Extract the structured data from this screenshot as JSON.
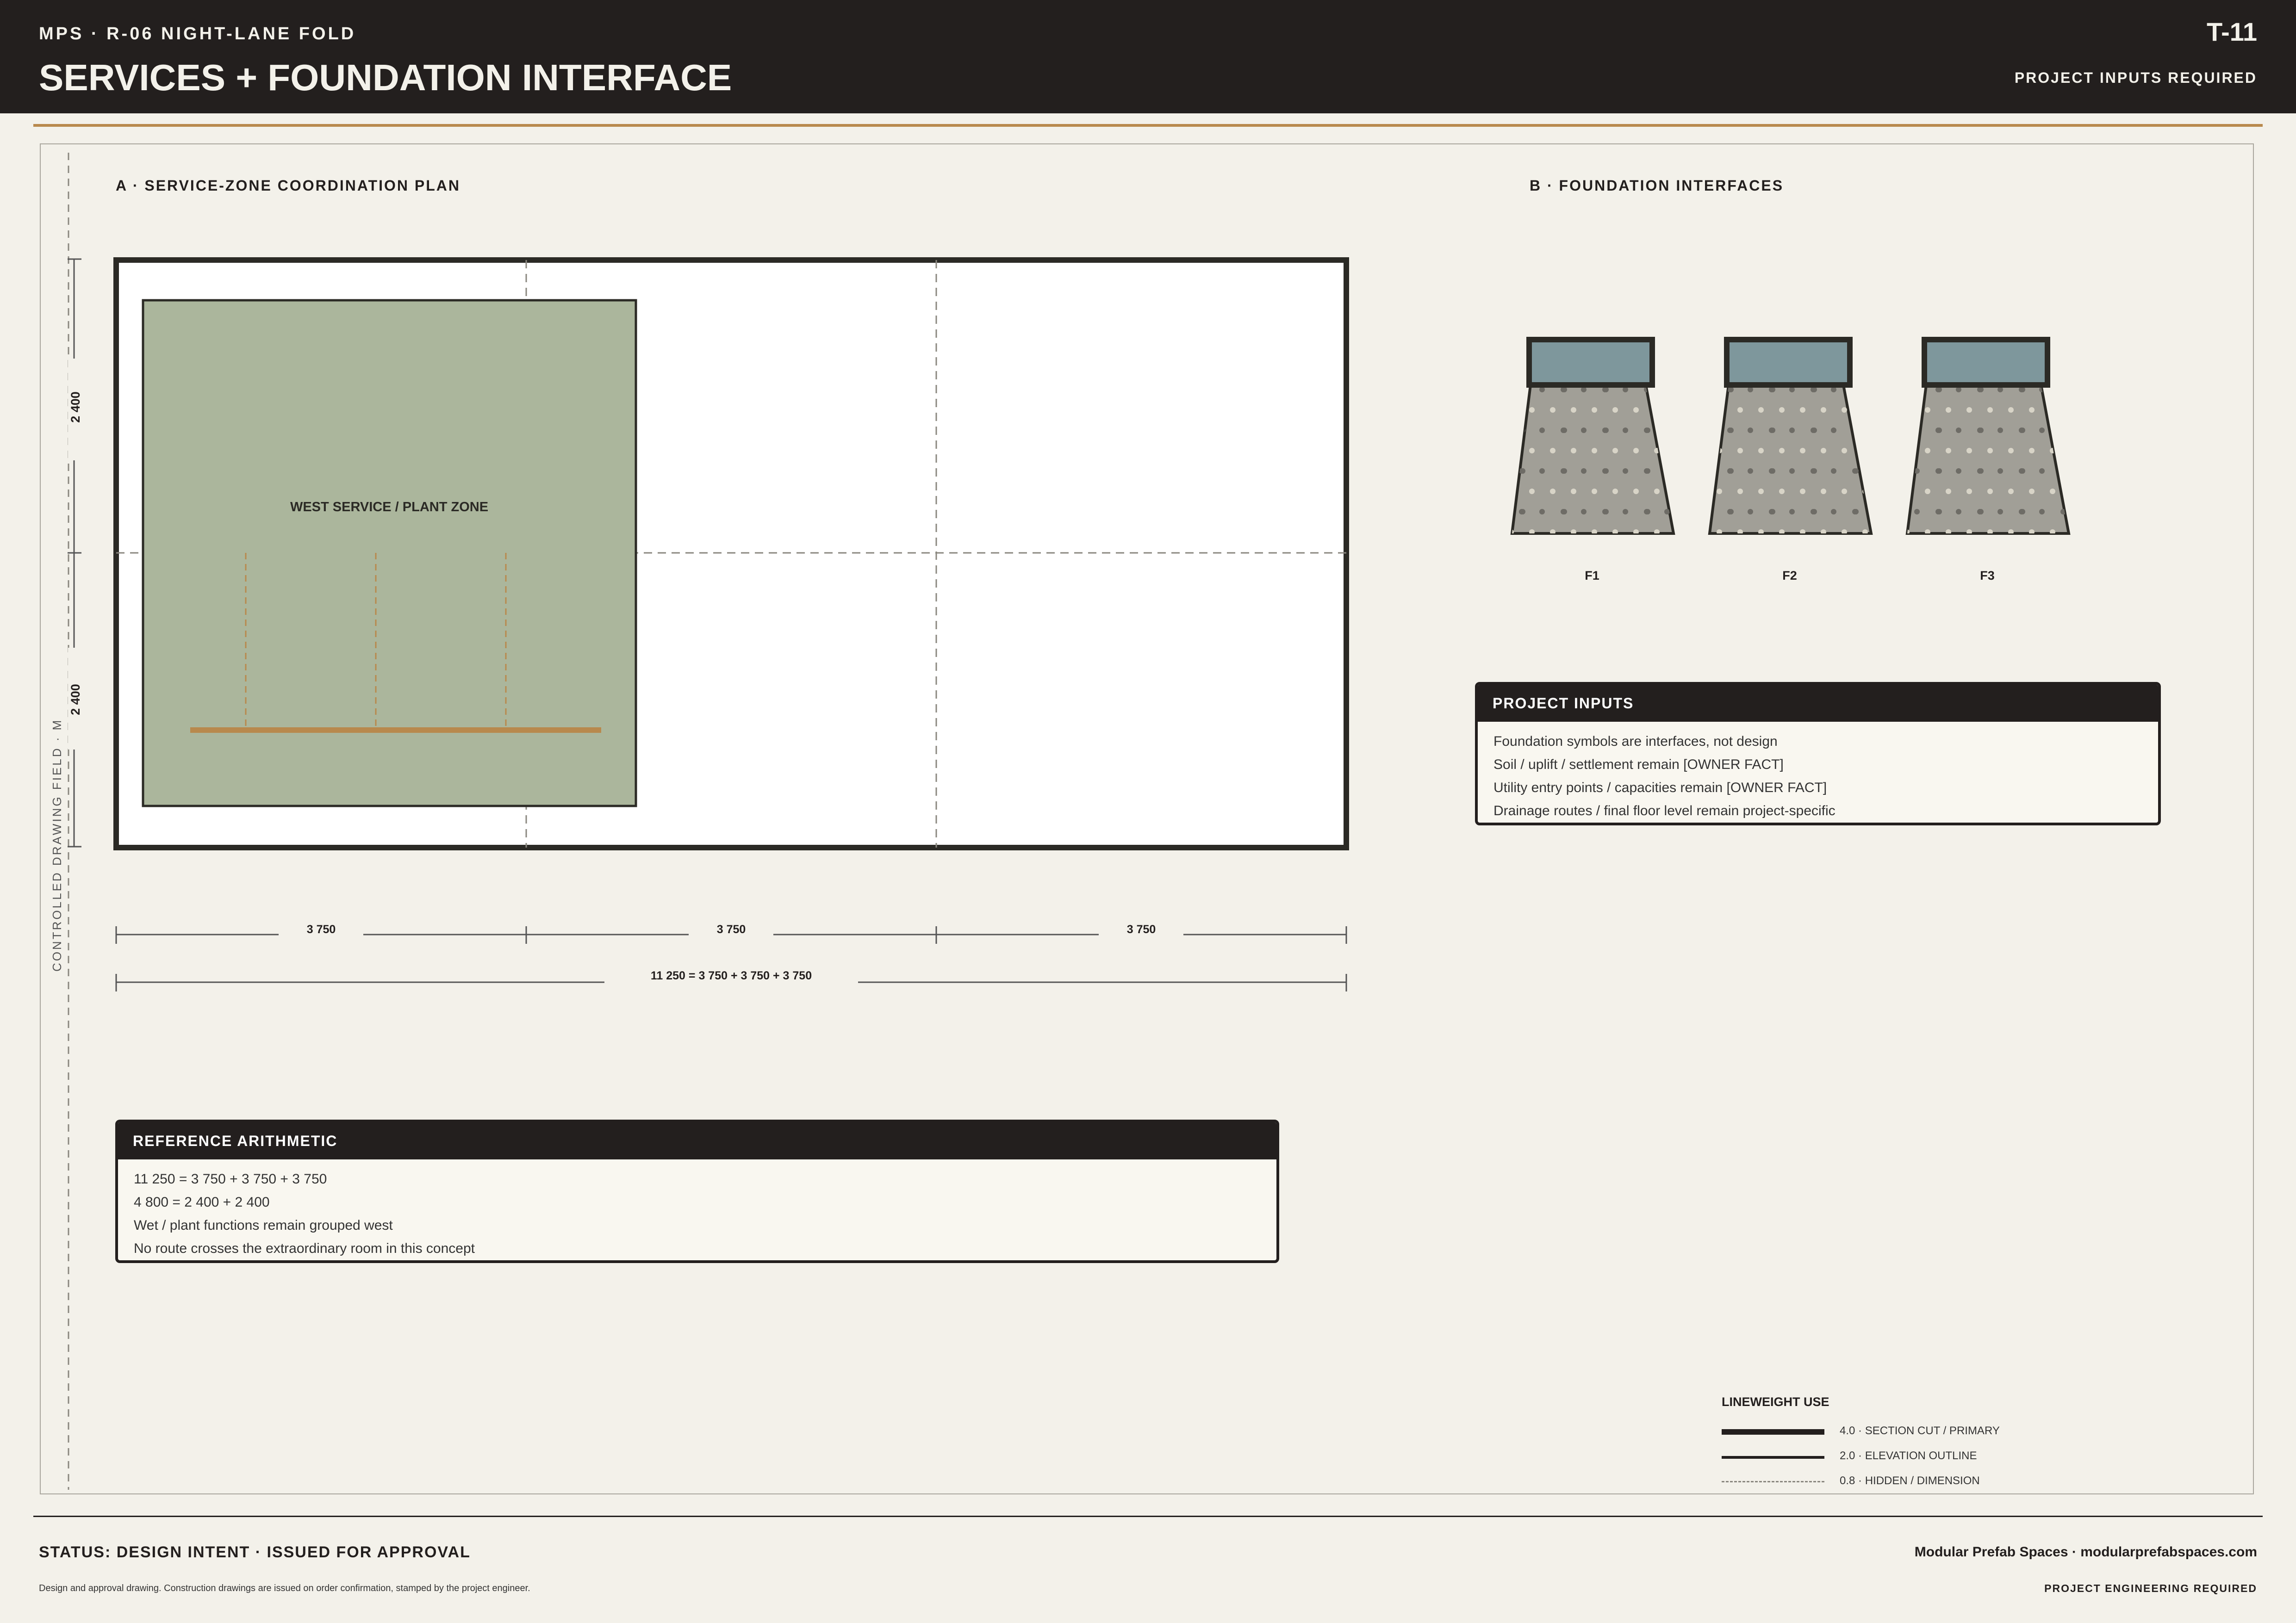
{
  "header": {
    "project_line": "MPS · R-06 NIGHT-LANE FOLD",
    "title": "SERVICES + FOUNDATION INTERFACE",
    "sheet_no": "T-11",
    "status": "PROJECT INPUTS REQUIRED"
  },
  "field_label": "CONTROLLED DRAWING FIELD · M",
  "plan": {
    "title": "A · SERVICE-ZONE COORDINATION PLAN",
    "zone_label": "WEST SERVICE / PLANT ZONE",
    "vertical_dims": [
      "2 400",
      "2 400"
    ],
    "bay_dims": [
      "3 750",
      "3 750",
      "3 750"
    ],
    "total_dim": "11 250 = 3 750 + 3 750 + 3 750"
  },
  "foundation": {
    "title": "B · FOUNDATION INTERFACES",
    "pads": [
      "F1",
      "F2",
      "F3"
    ]
  },
  "project_inputs": {
    "title": "PROJECT INPUTS",
    "lines": [
      "Foundation symbols are interfaces, not design",
      "Soil / uplift / settlement remain [OWNER FACT]",
      "Utility entry points / capacities remain [OWNER FACT]",
      "Drainage routes / final floor level remain project-specific"
    ]
  },
  "reference": {
    "title": "REFERENCE ARITHMETIC",
    "lines": [
      "11 250 = 3 750 + 3 750 + 3 750",
      "4 800 = 2 400 + 2 400",
      "Wet / plant functions remain grouped west",
      "No route crosses the extraordinary room in this concept"
    ]
  },
  "legend": {
    "title": "LINEWEIGHT USE",
    "items": [
      "4.0 · SECTION CUT / PRIMARY",
      "2.0 · ELEVATION OUTLINE",
      "0.8 · HIDDEN / DIMENSION"
    ]
  },
  "footer": {
    "status": "STATUS: DESIGN INTENT · ISSUED FOR APPROVAL",
    "disclaimer": "Design and approval drawing. Construction drawings are issued on order confirmation, stamped by the project engineer.",
    "company": "Modular Prefab Spaces · modularprefabspaces.com",
    "engineering": "PROJECT ENGINEERING REQUIRED"
  },
  "colors": {
    "ink": "#231f1e",
    "paper": "#f3f1ea",
    "accent": "#b8894d",
    "service_zone": "#abb69c",
    "pad_cap": "#7e979c",
    "footing": "#a19f97"
  }
}
